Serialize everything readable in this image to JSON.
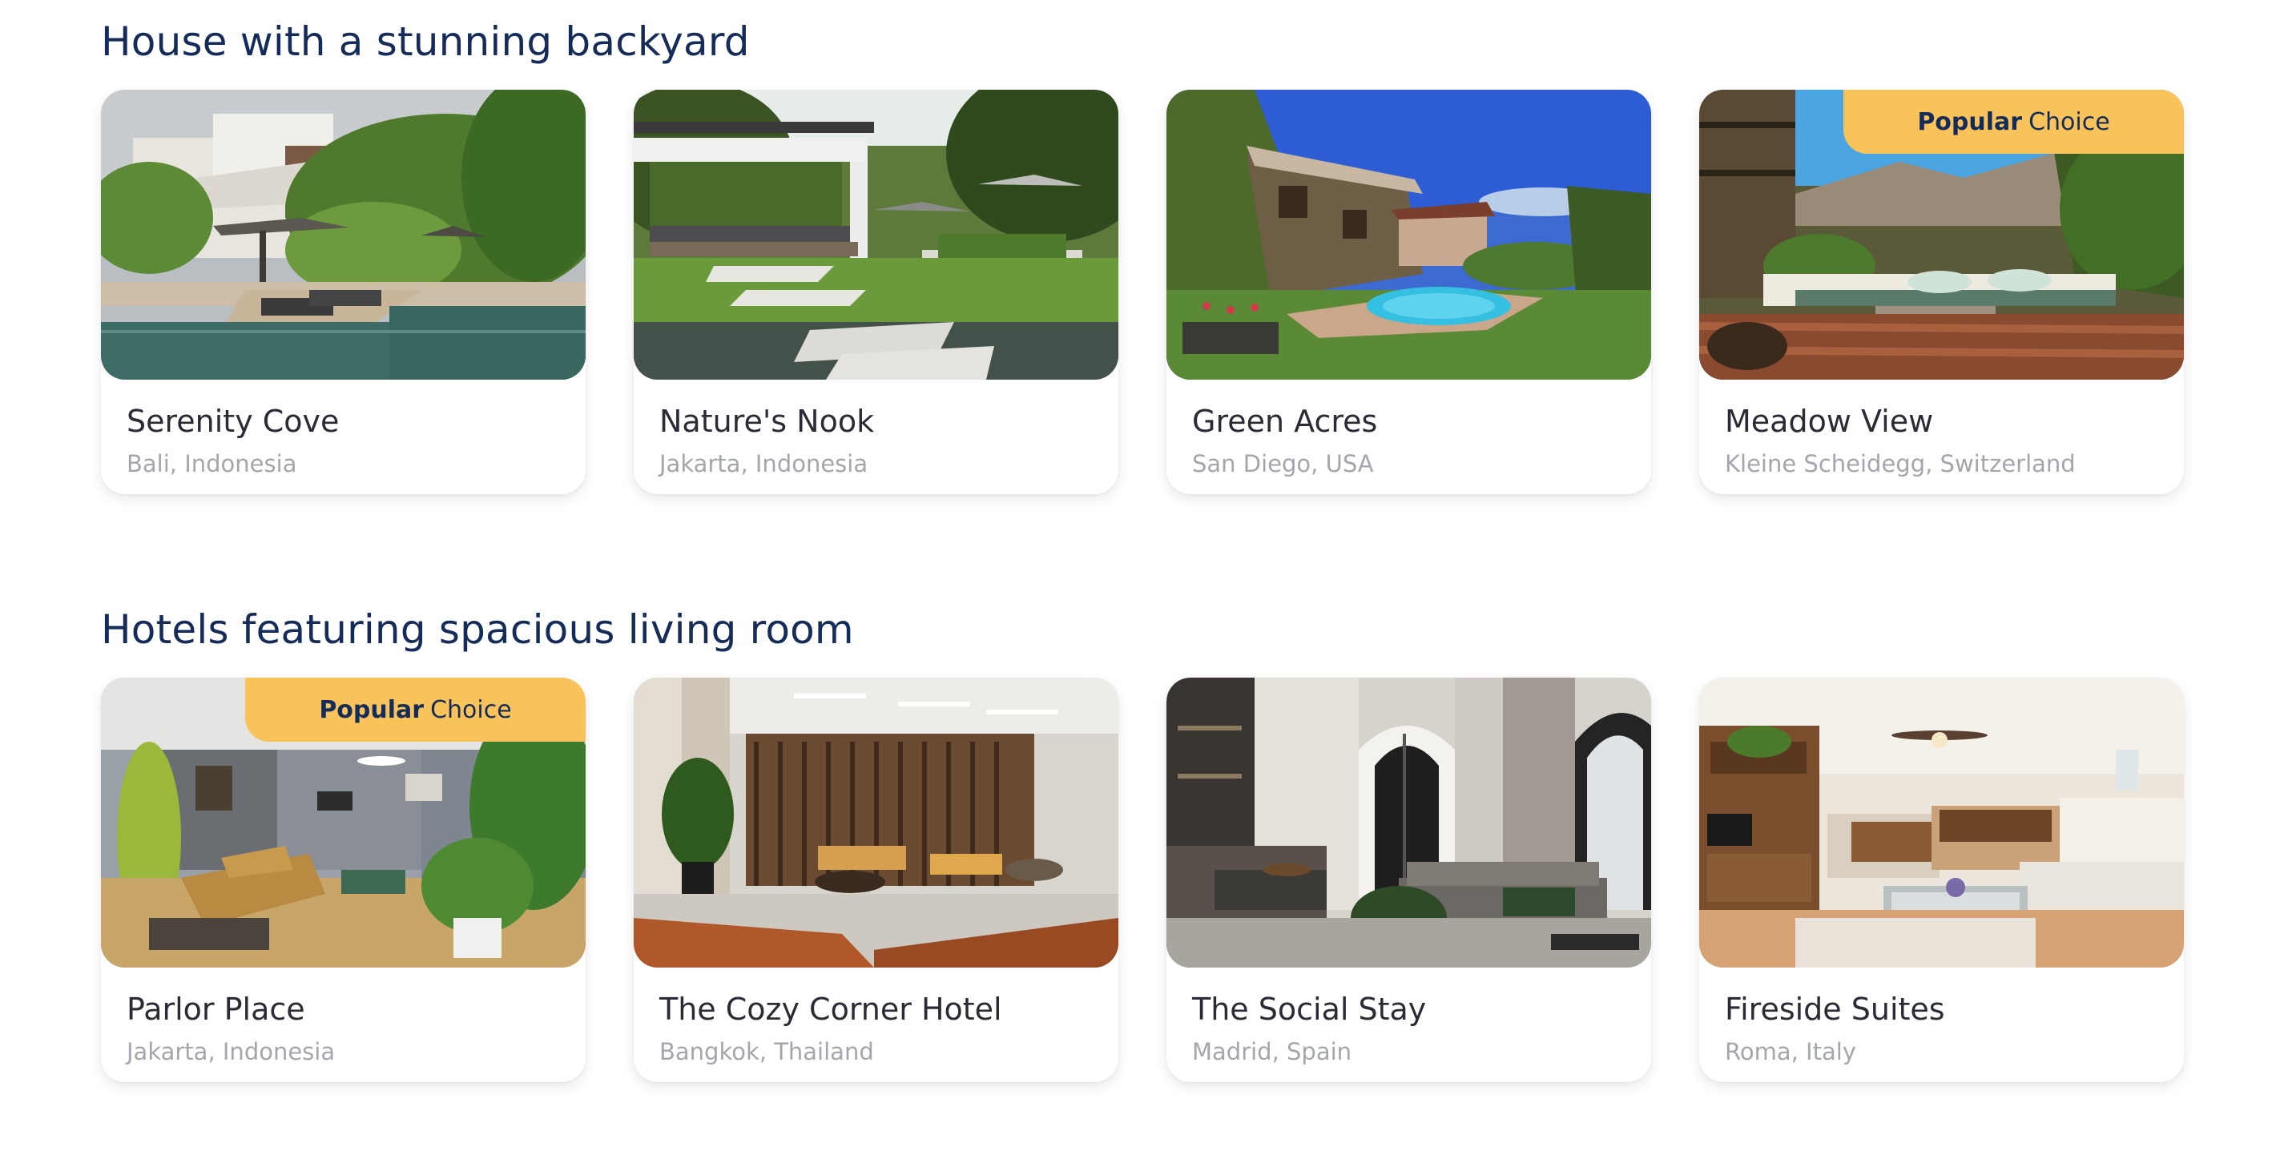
{
  "sections": [
    {
      "title": "House with a stunning backyard",
      "cards": [
        {
          "name": "Serenity Cove",
          "location": "Bali, Indonesia",
          "image": "tropical-villa-pool-photo"
        },
        {
          "name": "Nature's Nook",
          "location": "Jakarta, Indonesia",
          "image": "garden-pavilion-photo"
        },
        {
          "name": "Green Acres",
          "location": "San Diego, USA",
          "image": "ivy-courtyard-pool-photo"
        },
        {
          "name": "Meadow View",
          "location": "Kleine Scheidegg, Switzerland",
          "image": "mountain-terrace-lounge-photo",
          "badge": {
            "strong": "Popular",
            "light": "Choice"
          }
        }
      ]
    },
    {
      "title": "Hotels featuring spacious living room",
      "cards": [
        {
          "name": "Parlor Place",
          "location": "Jakarta, Indonesia",
          "image": "bright-lobby-photo",
          "badge": {
            "strong": "Popular",
            "light": "Choice"
          }
        },
        {
          "name": "The Cozy Corner Hotel",
          "location": "Bangkok, Thailand",
          "image": "wood-slat-lounge-photo"
        },
        {
          "name": "The Social Stay",
          "location": "Madrid, Spain",
          "image": "modern-living-dining-photo"
        },
        {
          "name": "Fireside Suites",
          "location": "Roma, Italy",
          "image": "open-living-room-photo"
        }
      ]
    }
  ],
  "colors": {
    "title": "#152c5b",
    "badge_bg": "#f8c35a",
    "card_name": "#2b2b36",
    "card_location": "#a3a6ad"
  }
}
